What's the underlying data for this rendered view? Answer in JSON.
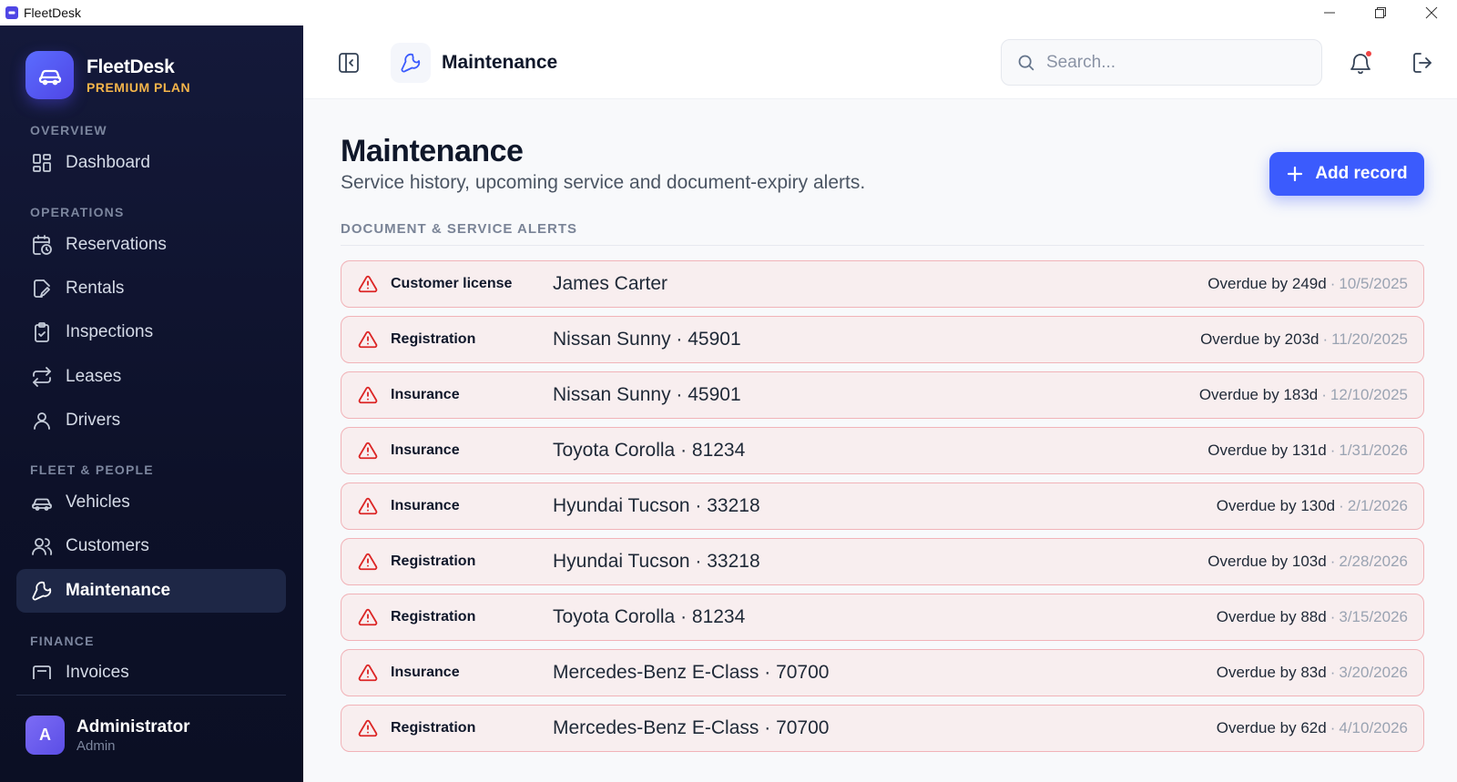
{
  "window": {
    "title": "FleetDesk"
  },
  "brand": {
    "name": "FleetDesk",
    "plan": "PREMIUM PLAN"
  },
  "sidebar": {
    "sections": [
      {
        "label": "OVERVIEW",
        "items": [
          {
            "label": "Dashboard",
            "icon": "dashboard-icon"
          }
        ]
      },
      {
        "label": "OPERATIONS",
        "items": [
          {
            "label": "Reservations",
            "icon": "calendar-clock-icon"
          },
          {
            "label": "Rentals",
            "icon": "file-edit-icon"
          },
          {
            "label": "Inspections",
            "icon": "clipboard-check-icon"
          },
          {
            "label": "Leases",
            "icon": "repeat-icon"
          },
          {
            "label": "Drivers",
            "icon": "user-icon"
          }
        ]
      },
      {
        "label": "FLEET & PEOPLE",
        "items": [
          {
            "label": "Vehicles",
            "icon": "car-icon"
          },
          {
            "label": "Customers",
            "icon": "users-icon"
          },
          {
            "label": "Maintenance",
            "icon": "wrench-icon",
            "active": true
          }
        ]
      },
      {
        "label": "FINANCE",
        "items": [
          {
            "label": "Invoices",
            "icon": "invoice-icon"
          }
        ]
      }
    ]
  },
  "user": {
    "initial": "A",
    "name": "Administrator",
    "role": "Admin"
  },
  "topbar": {
    "title": "Maintenance",
    "search_placeholder": "Search..."
  },
  "page": {
    "title": "Maintenance",
    "subtitle": "Service history, upcoming service and document-expiry alerts.",
    "add_button": "Add record",
    "alerts_label": "DOCUMENT & SERVICE ALERTS"
  },
  "alerts": [
    {
      "type": "Customer license",
      "subject": "James Carter",
      "overdue": "Overdue by 249d",
      "date": "10/5/2025"
    },
    {
      "type": "Registration",
      "subject": "Nissan Sunny · 45901",
      "overdue": "Overdue by 203d",
      "date": "11/20/2025"
    },
    {
      "type": "Insurance",
      "subject": "Nissan Sunny · 45901",
      "overdue": "Overdue by 183d",
      "date": "12/10/2025"
    },
    {
      "type": "Insurance",
      "subject": "Toyota Corolla · 81234",
      "overdue": "Overdue by 131d",
      "date": "1/31/2026"
    },
    {
      "type": "Insurance",
      "subject": "Hyundai Tucson · 33218",
      "overdue": "Overdue by 130d",
      "date": "2/1/2026"
    },
    {
      "type": "Registration",
      "subject": "Hyundai Tucson · 33218",
      "overdue": "Overdue by 103d",
      "date": "2/28/2026"
    },
    {
      "type": "Registration",
      "subject": "Toyota Corolla · 81234",
      "overdue": "Overdue by 88d",
      "date": "3/15/2026"
    },
    {
      "type": "Insurance",
      "subject": "Mercedes-Benz E-Class · 70700",
      "overdue": "Overdue by 83d",
      "date": "3/20/2026"
    },
    {
      "type": "Registration",
      "subject": "Mercedes-Benz E-Class · 70700",
      "overdue": "Overdue by 62d",
      "date": "4/10/2026"
    }
  ],
  "colors": {
    "accent": "#3b5bfd",
    "brand_plan": "#f5b54a",
    "alert_border": "#f1b3b8",
    "alert_bg": "#f8eeef",
    "alert_icon": "#dc2626"
  }
}
